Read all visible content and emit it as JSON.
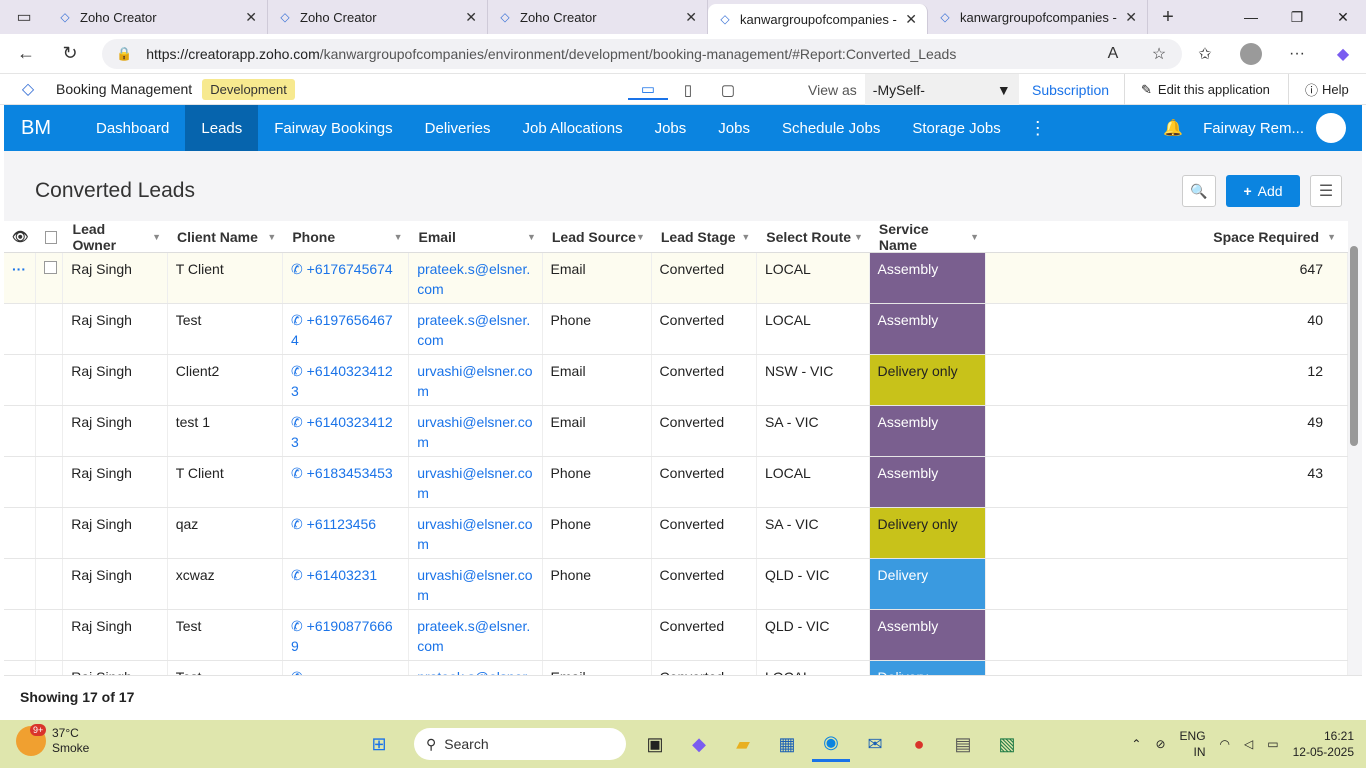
{
  "browser": {
    "tabs": [
      {
        "label": "Zoho Creator",
        "active": false
      },
      {
        "label": "Zoho Creator",
        "active": false
      },
      {
        "label": "Zoho Creator",
        "active": false
      },
      {
        "label": "kanwargroupofcompanies - B",
        "active": true
      },
      {
        "label": "kanwargroupofcompanies - B",
        "active": false
      }
    ],
    "url_host": "https://creatorapp.zoho.com",
    "url_path": "/kanwargroupofcompanies/environment/development/booking-management/#Report:Converted_Leads"
  },
  "appbar": {
    "app_name": "Booking Management",
    "env": "Development",
    "view_as_label": "View as",
    "view_as_value": "-MySelf-",
    "subscription": "Subscription",
    "edit": "Edit this application",
    "help": "Help"
  },
  "nav": {
    "logo": "BM",
    "items": [
      "Dashboard",
      "Leads",
      "Fairway Bookings",
      "Deliveries",
      "Job Allocations",
      "Jobs",
      "Jobs",
      "Schedule Jobs",
      "Storage Jobs"
    ],
    "active": "Leads",
    "user": "Fairway Rem..."
  },
  "report": {
    "title": "Converted Leads",
    "add_label": "Add",
    "columns": [
      "Lead Owner",
      "Client Name",
      "Phone",
      "Email",
      "Lead Source",
      "Lead Stage",
      "Select Route",
      "Service Name",
      "Space Required"
    ],
    "rows": [
      {
        "owner": "Raj Singh",
        "client": "T Client",
        "phone": "+6176745674",
        "email": "prateek.s@elsner.com",
        "source": "Email",
        "stage": "Converted",
        "route": "LOCAL",
        "service": "Assembly",
        "space": "647"
      },
      {
        "owner": "Raj Singh",
        "client": "Test",
        "phone": "+61976564674",
        "email": "prateek.s@elsner.com",
        "source": "Phone",
        "stage": "Converted",
        "route": "LOCAL",
        "service": "Assembly",
        "space": "40"
      },
      {
        "owner": "Raj Singh",
        "client": "Client2",
        "phone": "+61403234123",
        "email": "urvashi@elsner.com",
        "source": "Email",
        "stage": "Converted",
        "route": "NSW - VIC",
        "service": "Delivery only",
        "space": "12"
      },
      {
        "owner": "Raj Singh",
        "client": "test 1",
        "phone": "+61403234123",
        "email": "urvashi@elsner.com",
        "source": "Email",
        "stage": "Converted",
        "route": "SA - VIC",
        "service": "Assembly",
        "space": "49"
      },
      {
        "owner": "Raj Singh",
        "client": "T Client",
        "phone": "+6183453453",
        "email": "urvashi@elsner.com",
        "source": "Phone",
        "stage": "Converted",
        "route": "LOCAL",
        "service": "Assembly",
        "space": "43"
      },
      {
        "owner": "Raj Singh",
        "client": "qaz",
        "phone": "+61123456",
        "email": "urvashi@elsner.com",
        "source": "Phone",
        "stage": "Converted",
        "route": "SA - VIC",
        "service": "Delivery only",
        "space": ""
      },
      {
        "owner": "Raj Singh",
        "client": "xcwaz",
        "phone": "+61403231",
        "email": "urvashi@elsner.com",
        "source": "Phone",
        "stage": "Converted",
        "route": "QLD - VIC",
        "service": "Delivery",
        "space": ""
      },
      {
        "owner": "Raj Singh",
        "client": "Test",
        "phone": "+61908776669",
        "email": "prateek.s@elsner.com",
        "source": "",
        "stage": "Converted",
        "route": "QLD - VIC",
        "service": "Assembly",
        "space": ""
      },
      {
        "owner": "Raj Singh",
        "client": "Test",
        "phone": "",
        "email": "prateek.s@elsner.com",
        "source": "Email",
        "stage": "Converted",
        "route": "LOCAL",
        "service": "Delivery",
        "space": ""
      }
    ],
    "service_colors": {
      "Assembly": "#7a5f8f",
      "Delivery only": "#c8c21a",
      "Delivery": "#3a9ae0"
    },
    "footer": "Showing 17 of 17"
  },
  "taskbar": {
    "temp": "37°C",
    "weather": "Smoke",
    "badge": "9+",
    "search": "Search",
    "lang1": "ENG",
    "lang2": "IN",
    "time": "16:21",
    "date": "12-05-2025"
  }
}
